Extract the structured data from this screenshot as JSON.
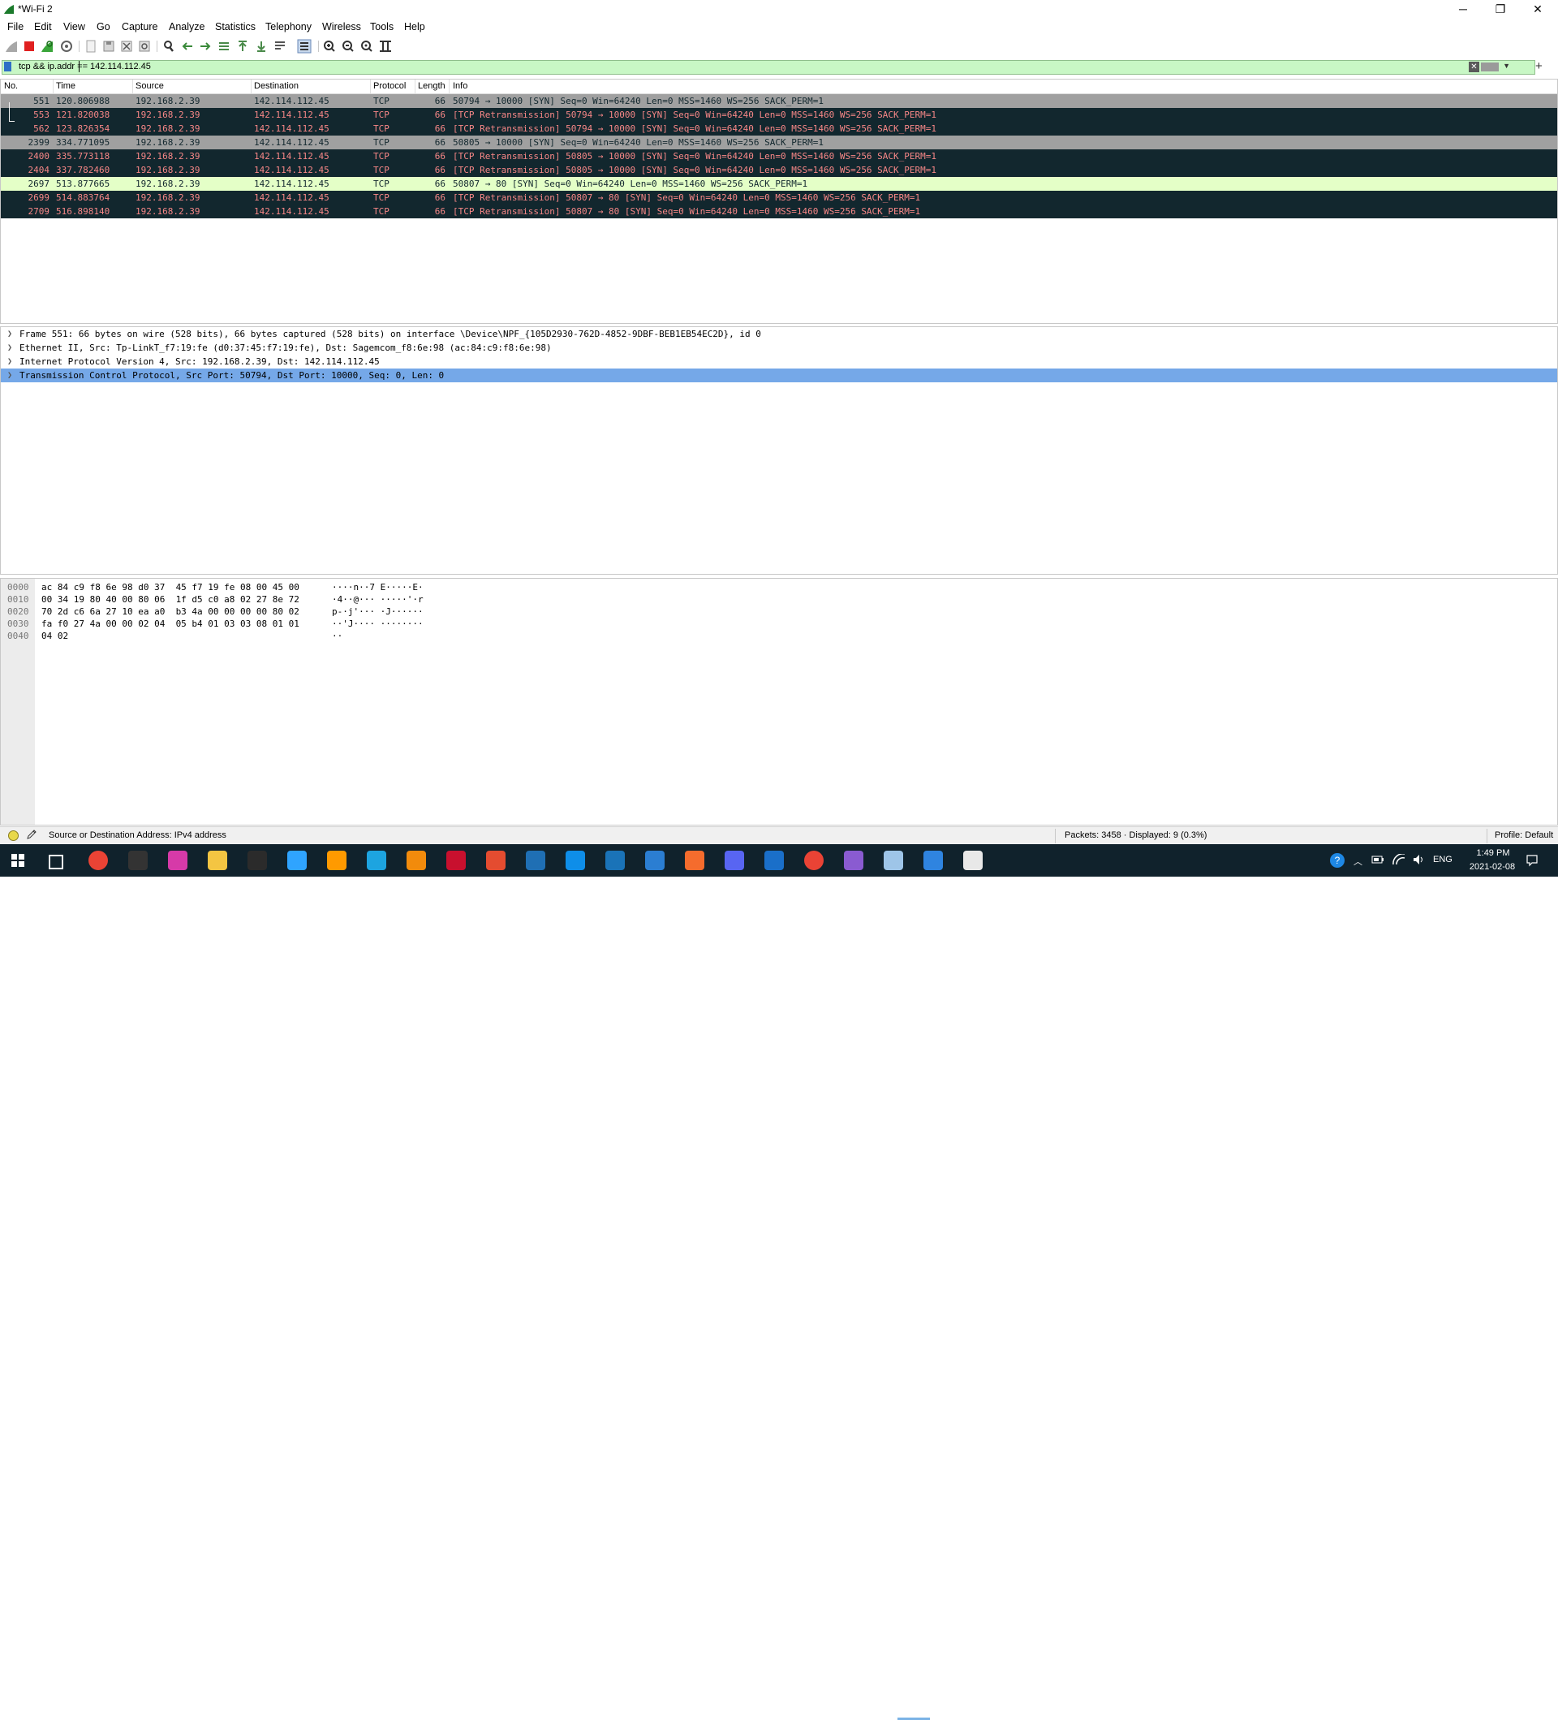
{
  "window": {
    "title": "*Wi-Fi 2",
    "minimize": "─",
    "maximize": "❐",
    "close": "✕"
  },
  "menu": [
    "File",
    "Edit",
    "View",
    "Go",
    "Capture",
    "Analyze",
    "Statistics",
    "Telephony",
    "Wireless",
    "Tools",
    "Help"
  ],
  "filter": {
    "value": "tcp && ip.addr == 142.114.112.45",
    "add_label": "+"
  },
  "packet_list": {
    "columns": [
      "No.",
      "Time",
      "Source",
      "Destination",
      "Protocol",
      "Length",
      "Info"
    ],
    "rows": [
      {
        "no": "551",
        "time": "120.806988",
        "src": "192.168.2.39",
        "dst": "142.114.112.45",
        "proto": "TCP",
        "len": "66",
        "info": "50794 → 10000 [SYN] Seq=0 Win=64240 Len=0 MSS=1460 WS=256 SACK_PERM=1",
        "style": "grey"
      },
      {
        "no": "553",
        "time": "121.820038",
        "src": "192.168.2.39",
        "dst": "142.114.112.45",
        "proto": "TCP",
        "len": "66",
        "info": "[TCP Retransmission] 50794 → 10000 [SYN] Seq=0 Win=64240 Len=0 MSS=1460 WS=256 SACK_PERM=1",
        "style": "dark"
      },
      {
        "no": "562",
        "time": "123.826354",
        "src": "192.168.2.39",
        "dst": "142.114.112.45",
        "proto": "TCP",
        "len": "66",
        "info": "[TCP Retransmission] 50794 → 10000 [SYN] Seq=0 Win=64240 Len=0 MSS=1460 WS=256 SACK_PERM=1",
        "style": "dark"
      },
      {
        "no": "2399",
        "time": "334.771095",
        "src": "192.168.2.39",
        "dst": "142.114.112.45",
        "proto": "TCP",
        "len": "66",
        "info": "50805 → 10000 [SYN] Seq=0 Win=64240 Len=0 MSS=1460 WS=256 SACK_PERM=1",
        "style": "grey"
      },
      {
        "no": "2400",
        "time": "335.773118",
        "src": "192.168.2.39",
        "dst": "142.114.112.45",
        "proto": "TCP",
        "len": "66",
        "info": "[TCP Retransmission] 50805 → 10000 [SYN] Seq=0 Win=64240 Len=0 MSS=1460 WS=256 SACK_PERM=1",
        "style": "dark"
      },
      {
        "no": "2404",
        "time": "337.782460",
        "src": "192.168.2.39",
        "dst": "142.114.112.45",
        "proto": "TCP",
        "len": "66",
        "info": "[TCP Retransmission] 50805 → 10000 [SYN] Seq=0 Win=64240 Len=0 MSS=1460 WS=256 SACK_PERM=1",
        "style": "dark"
      },
      {
        "no": "2697",
        "time": "513.877665",
        "src": "192.168.2.39",
        "dst": "142.114.112.45",
        "proto": "TCP",
        "len": "66",
        "info": "50807 → 80 [SYN] Seq=0 Win=64240 Len=0 MSS=1460 WS=256 SACK_PERM=1",
        "style": "green"
      },
      {
        "no": "2699",
        "time": "514.883764",
        "src": "192.168.2.39",
        "dst": "142.114.112.45",
        "proto": "TCP",
        "len": "66",
        "info": "[TCP Retransmission] 50807 → 80 [SYN] Seq=0 Win=64240 Len=0 MSS=1460 WS=256 SACK_PERM=1",
        "style": "dark"
      },
      {
        "no": "2709",
        "time": "516.898140",
        "src": "192.168.2.39",
        "dst": "142.114.112.45",
        "proto": "TCP",
        "len": "66",
        "info": "[TCP Retransmission] 50807 → 80 [SYN] Seq=0 Win=64240 Len=0 MSS=1460 WS=256 SACK_PERM=1",
        "style": "dark"
      }
    ]
  },
  "details": [
    {
      "text": "Frame 551: 66 bytes on wire (528 bits), 66 bytes captured (528 bits) on interface \\Device\\NPF_{105D2930-762D-4852-9DBF-BEB1EB54EC2D}, id 0",
      "selected": false
    },
    {
      "text": "Ethernet II, Src: Tp-LinkT_f7:19:fe (d0:37:45:f7:19:fe), Dst: Sagemcom_f8:6e:98 (ac:84:c9:f8:6e:98)",
      "selected": false
    },
    {
      "text": "Internet Protocol Version 4, Src: 192.168.2.39, Dst: 142.114.112.45",
      "selected": false
    },
    {
      "text": "Transmission Control Protocol, Src Port: 50794, Dst Port: 10000, Seq: 0, Len: 0",
      "selected": true
    }
  ],
  "bytes": [
    {
      "offset": "0000",
      "hex": "ac 84 c9 f8 6e 98 d0 37  45 f7 19 fe 08 00 45 00",
      "ascii": "····n··7 E·····E·"
    },
    {
      "offset": "0010",
      "hex": "00 34 19 80 40 00 80 06  1f d5 c0 a8 02 27 8e 72",
      "ascii": "·4··@··· ·····'·r"
    },
    {
      "offset": "0020",
      "hex": "70 2d c6 6a 27 10 ea a0  b3 4a 00 00 00 00 80 02",
      "ascii": "p-·j'··· ·J······"
    },
    {
      "offset": "0030",
      "hex": "fa f0 27 4a 00 00 02 04  05 b4 01 03 03 08 01 01",
      "ascii": "··'J···· ········"
    },
    {
      "offset": "0040",
      "hex": "04 02",
      "ascii": "··"
    }
  ],
  "status": {
    "message": "Source or Destination Address: IPv4 address",
    "packets": "Packets: 3458 · Displayed: 9 (0.3%)",
    "profile": "Profile: Default"
  },
  "taskbar": {
    "lang": "ENG",
    "time": "1:49 PM",
    "date": "2021-02-08",
    "icons": [
      "windows-start-icon",
      "task-view-icon",
      "chrome-icon",
      "inkscape-icon",
      "itunes-icon",
      "file-explorer-icon",
      "terminal-icon",
      "photoshop-icon",
      "illustrator-icon",
      "edge-icon",
      "vlc-icon",
      "mcafee-icon",
      "git-icon",
      "quicktime-icon",
      "teamviewer-icon",
      "mail-app-icon",
      "vscode-icon",
      "origin-icon",
      "discord-icon",
      "outlook-icon",
      "chrome-icon-2",
      "wireless-app-icon",
      "notepad-icon",
      "wireshark-icon",
      "paint-icon"
    ],
    "colors": [
      "#1e88e5",
      "#ffffff",
      "#ea4335",
      "#333333",
      "#d63aa8",
      "#f4c542",
      "#2b2b2b",
      "#2fa4ff",
      "#ff9a00",
      "#1da4e0",
      "#f28b0c",
      "#c8102e",
      "#e44c30",
      "#1f6fb4",
      "#0e8ee9",
      "#1a73b8",
      "#2b7ed2",
      "#f56c2d",
      "#5865f2",
      "#1a6fc9",
      "#ea4335",
      "#8a5bd1",
      "#9ec5e8",
      "#2f84e0",
      "#e8e8e8"
    ]
  }
}
